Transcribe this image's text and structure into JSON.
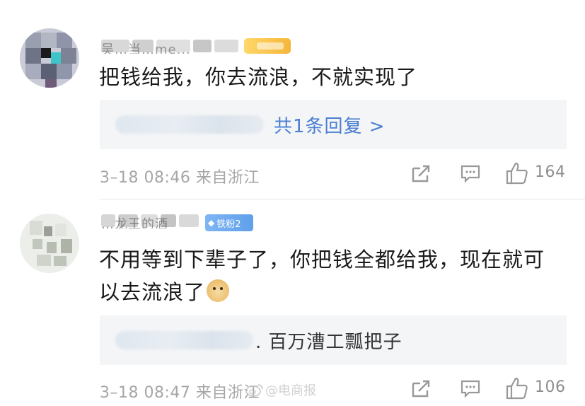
{
  "comments": [
    {
      "text": "把钱给我，你去流浪，不就实现了",
      "reply_link": "共1条回复 >",
      "meta": "3–18 08:46 来自浙江",
      "likes": "164",
      "username_partial": "吴…当…me..."
    },
    {
      "text": "不用等到下辈子了，你把钱全都给我，现在就可以去流浪了",
      "emoji": "doge-emoji",
      "username_partial": "…龙王的酒",
      "badge_label": "铁粉2",
      "reply_snippet": ". 百万漕工瓢把子",
      "meta": "3–18 08:47 来自浙江",
      "likes": "106"
    }
  ],
  "icons": {
    "share": "share-icon",
    "comment": "comment-icon",
    "like": "thumbs-up-icon"
  },
  "colors": {
    "link": "#4b7fd1",
    "meta_gray": "#a6a6a6",
    "reply_bg": "#f4f5f7"
  },
  "watermark": {
    "text": "@电商报"
  }
}
